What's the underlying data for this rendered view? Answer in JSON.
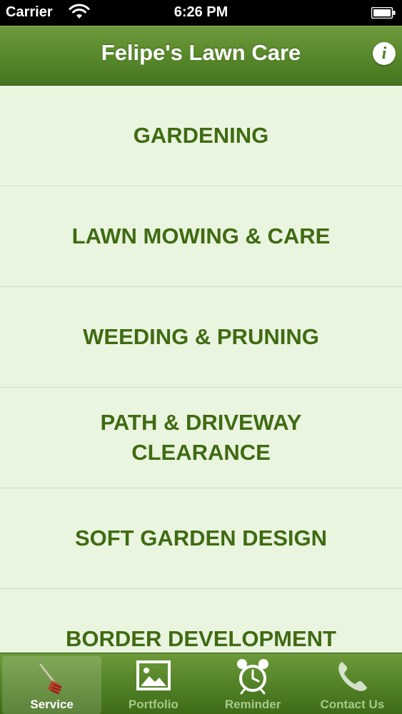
{
  "status_bar": {
    "carrier": "Carrier",
    "time": "6:26 PM"
  },
  "nav": {
    "title": "Felipe's Lawn Care",
    "info_glyph": "i"
  },
  "services": [
    {
      "label": "GARDENING"
    },
    {
      "label": "LAWN MOWING & CARE"
    },
    {
      "label": "WEEDING & PRUNING"
    },
    {
      "label": "PATH & DRIVEWAY CLEARANCE"
    },
    {
      "label": "SOFT GARDEN DESIGN"
    },
    {
      "label": "BORDER DEVELOPMENT"
    }
  ],
  "tabs": [
    {
      "label": "Service",
      "icon": "rake-icon",
      "active": true
    },
    {
      "label": "Portfolio",
      "icon": "picture-icon",
      "active": false
    },
    {
      "label": "Reminder",
      "icon": "alarm-clock-icon",
      "active": false
    },
    {
      "label": "Contact Us",
      "icon": "phone-icon",
      "active": false
    }
  ],
  "colors": {
    "brand_green": "#4f7f26",
    "list_background": "#eaf5e0",
    "list_text": "#3f6b12"
  }
}
